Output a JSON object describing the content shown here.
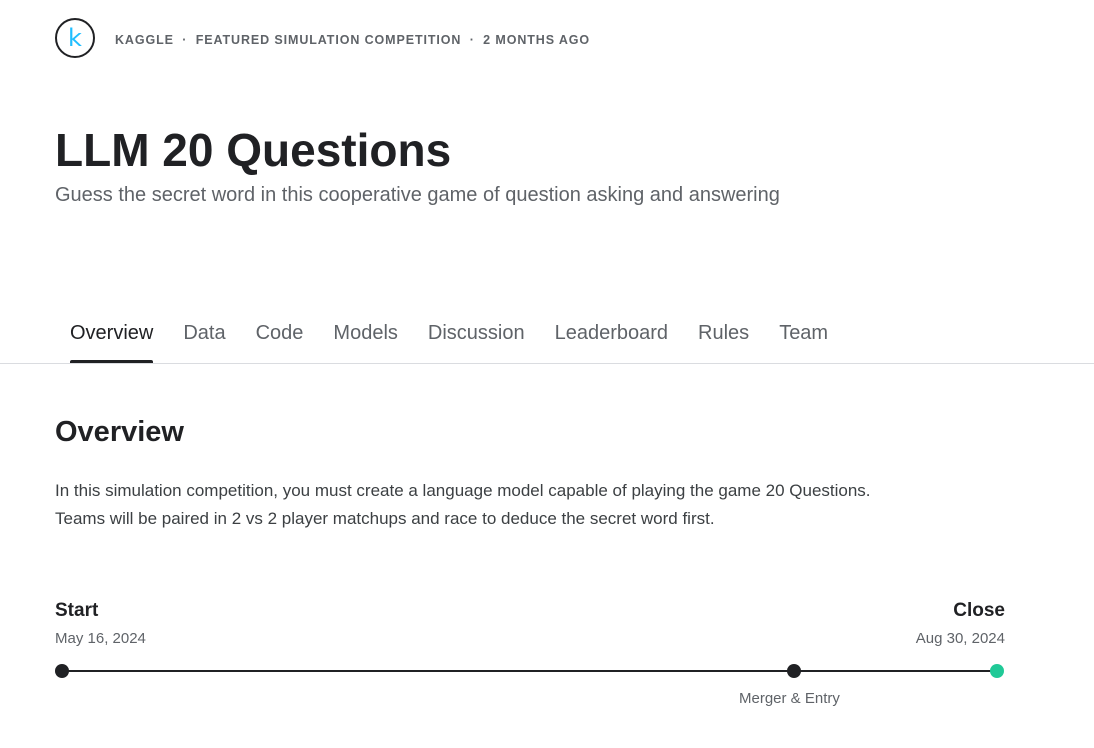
{
  "header": {
    "logo_letter": "k",
    "meta": [
      "KAGGLE",
      "FEATURED SIMULATION COMPETITION",
      "2 MONTHS AGO"
    ],
    "meta_separator": "·"
  },
  "competition": {
    "title": "LLM 20 Questions",
    "subtitle": "Guess the secret word in this cooperative game of question asking and answering"
  },
  "tabs": [
    {
      "label": "Overview",
      "active": true
    },
    {
      "label": "Data"
    },
    {
      "label": "Code"
    },
    {
      "label": "Models"
    },
    {
      "label": "Discussion"
    },
    {
      "label": "Leaderboard"
    },
    {
      "label": "Rules"
    },
    {
      "label": "Team"
    }
  ],
  "overview": {
    "heading": "Overview",
    "lines": [
      "In this simulation competition, you must create a language model capable of playing the game 20 Questions.",
      "Teams will be paired in 2 vs 2 player matchups and race to deduce the secret word first."
    ]
  },
  "timeline": {
    "start": {
      "label": "Start",
      "date": "May 16, 2024"
    },
    "close": {
      "label": "Close",
      "date": "Aug 30, 2024"
    },
    "milestone": {
      "label": "Merger & Entry"
    },
    "colors": {
      "done": "#202124",
      "current": "#20c997"
    }
  },
  "colors": {
    "brand": "#20beff",
    "text": "#202124",
    "muted": "#5f6368"
  }
}
